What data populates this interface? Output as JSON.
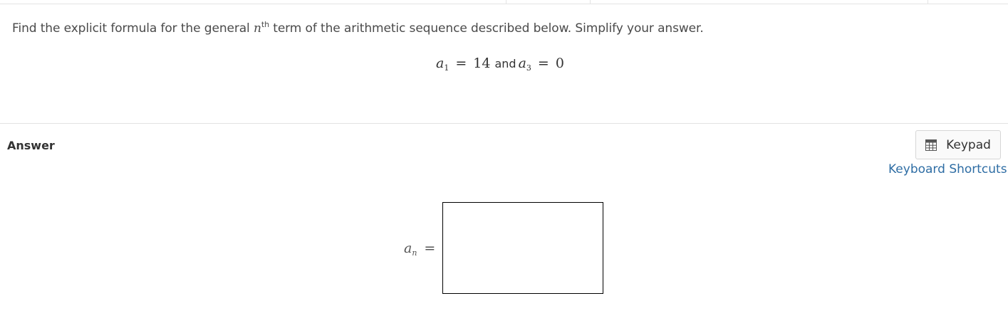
{
  "question": {
    "text_before": "Find the explicit formula for the general ",
    "var_n": "n",
    "superscript": "th",
    "text_after": " term of the arithmetic sequence described below. Simplify your answer."
  },
  "given": {
    "a1_letter": "a",
    "a1_sub": "1",
    "eq1": "=",
    "value1": "14",
    "and_word": "and",
    "a3_letter": "a",
    "a3_sub": "3",
    "eq2": "=",
    "value2": "0"
  },
  "answer_section": {
    "label": "Answer",
    "keypad_label": "Keypad",
    "keyboard_shortcuts": "Keyboard Shortcuts",
    "an_letter": "a",
    "an_sub": "n",
    "an_eq": "=",
    "input_value": ""
  },
  "icons": {
    "keypad": "keypad-icon"
  }
}
